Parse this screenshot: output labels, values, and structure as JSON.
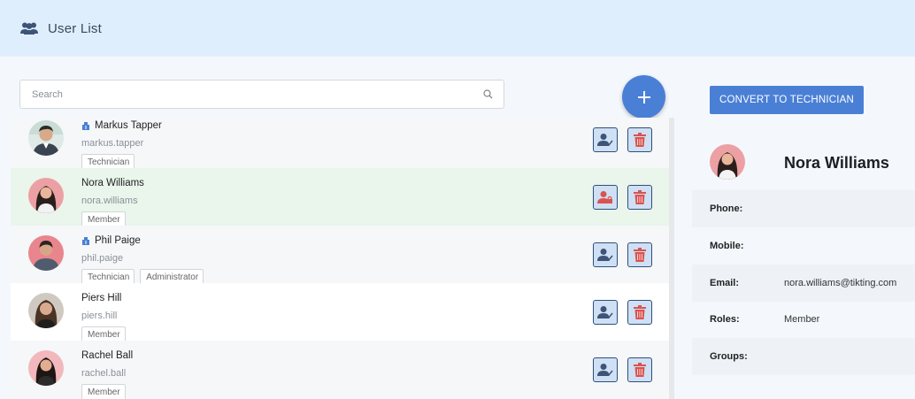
{
  "header": {
    "title": "User List",
    "icon": "users-icon"
  },
  "search": {
    "placeholder": "Search",
    "value": ""
  },
  "users": [
    {
      "name": "Markus Tapper",
      "username": "markus.tapper",
      "badges": [
        "Technician"
      ],
      "technician": true
    },
    {
      "name": "Nora Williams",
      "username": "nora.williams",
      "badges": [
        "Member"
      ],
      "technician": false,
      "selected": true
    },
    {
      "name": "Phil Paige",
      "username": "phil.paige",
      "badges": [
        "Technician",
        "Administrator"
      ],
      "technician": true
    },
    {
      "name": "Piers Hill",
      "username": "piers.hill",
      "badges": [
        "Member"
      ],
      "technician": false
    },
    {
      "name": "Rachel Ball",
      "username": "rachel.ball",
      "badges": [
        "Member"
      ],
      "technician": false
    }
  ],
  "details": {
    "convert_label": "CONVERT TO TECHNICIAN",
    "name": "Nora Williams",
    "fields": [
      {
        "label": "Phone:",
        "value": ""
      },
      {
        "label": "Mobile:",
        "value": ""
      },
      {
        "label": "Email:",
        "value": "nora.williams@tikting.com"
      },
      {
        "label": "Roles:",
        "value": "Member"
      },
      {
        "label": "Groups:",
        "value": ""
      }
    ]
  },
  "colors": {
    "header_bg": "#dfeefc",
    "accent": "#4a7fd6",
    "selected_row": "#eaf5ec",
    "delete_icon": "#d9534f",
    "action_bg": "#cfe0f5"
  }
}
